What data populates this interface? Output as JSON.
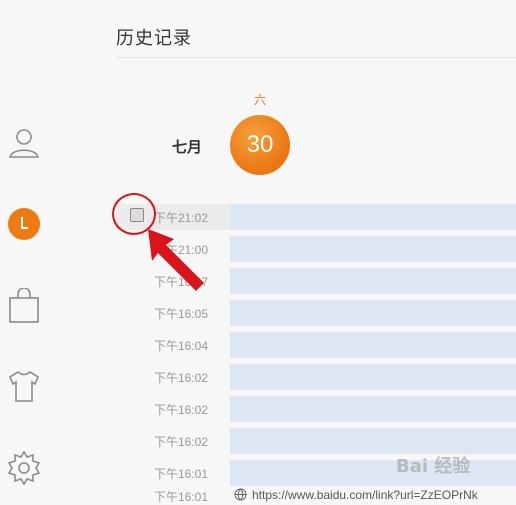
{
  "header": {
    "title": "历史记录"
  },
  "sidebar": {
    "items": [
      {
        "icon": "user-icon"
      },
      {
        "icon": "clock-icon",
        "active": true,
        "accent": "#ee7a12",
        "glyph": "L"
      },
      {
        "icon": "bag-icon"
      },
      {
        "icon": "shirt-icon"
      },
      {
        "icon": "gear-icon"
      }
    ]
  },
  "date": {
    "weekday": "六",
    "month": "七月",
    "day": "30",
    "accent": "#ea7512"
  },
  "history": {
    "rows": [
      {
        "time": "下午21:02",
        "selected": true
      },
      {
        "time": "下午21:00"
      },
      {
        "time": "下午16:07"
      },
      {
        "time": "下午16:05"
      },
      {
        "time": "下午16:04"
      },
      {
        "time": "下午16:02"
      },
      {
        "time": "下午16:02"
      },
      {
        "time": "下午16:02"
      },
      {
        "time": "下午16:01"
      }
    ],
    "last_row": {
      "time": "下午16:01",
      "url": "https://www.baidu.com/link?url=ZzEOPrNk"
    }
  },
  "colors": {
    "row_bar": "#dde7f3",
    "annotation": "#d9151b"
  },
  "watermark": {
    "text": "Bai 经验"
  }
}
